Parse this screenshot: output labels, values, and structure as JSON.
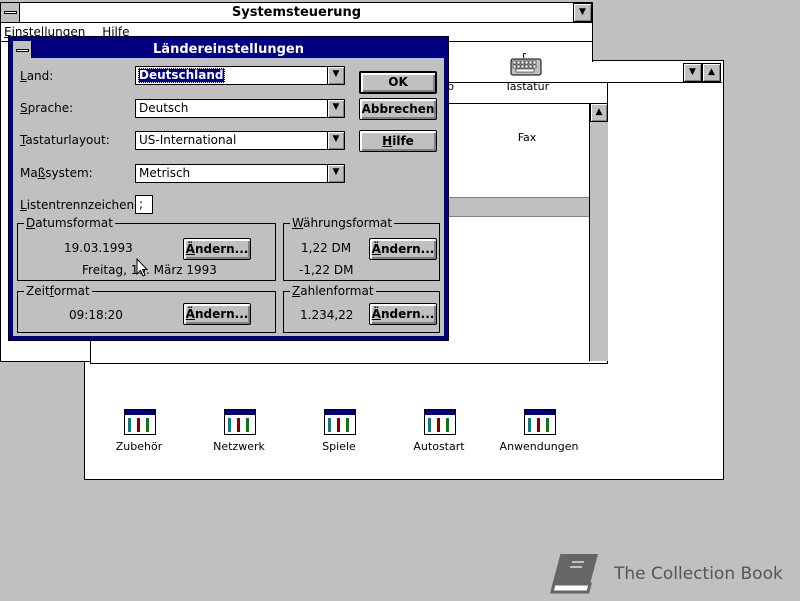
{
  "control_panel": {
    "title": "Systemsteuerung",
    "menu": [
      "Einstellungen",
      "Hilfe"
    ],
    "icons": [
      {
        "label": "Tastatur",
        "icon": "keyboard-icon"
      },
      {
        "label": "Fax",
        "icon": "fax-icon"
      }
    ],
    "partial_label": "p"
  },
  "program_manager": {
    "groups": [
      {
        "label": "Zubehör",
        "icon": "program-group-icon"
      },
      {
        "label": "Netzwerk",
        "icon": "program-group-icon"
      },
      {
        "label": "Spiele",
        "icon": "program-group-icon"
      },
      {
        "label": "Autostart",
        "icon": "program-group-icon"
      },
      {
        "label": "Anwendungen",
        "icon": "program-group-icon"
      }
    ]
  },
  "dialog": {
    "title": "Ländereinstellungen",
    "fields": {
      "land": {
        "label_u": "L",
        "label_rest": "and:",
        "value": "Deutschland"
      },
      "sprache": {
        "label_u": "S",
        "label_rest": "prache:",
        "value": "Deutsch"
      },
      "tastatur": {
        "label_u": "T",
        "label_rest": "astaturlayout:",
        "value": "US-International"
      },
      "mass": {
        "label_pre": "Ma",
        "label_u": "ß",
        "label_rest": "system:",
        "value": "Metrisch"
      },
      "listen": {
        "label_pre": "",
        "label_u": "L",
        "label_rest": "istentrennzeichen:",
        "value": ";"
      }
    },
    "buttons": {
      "ok": "OK",
      "cancel": "Abbrechen",
      "help_u": "H",
      "help_rest": "ilfe"
    },
    "groups": {
      "datum": {
        "title_u": "D",
        "title_rest": "atumsformat",
        "short": "19.03.1993",
        "long": "Freitag, 19. März 1993"
      },
      "waehrung": {
        "title_u": "W",
        "title_rest": "ährungsformat",
        "positive": "1,22 DM",
        "negative": "-1,22 DM"
      },
      "zeit": {
        "title_pre": "Zeit",
        "title_u": "f",
        "title_rest": "ormat",
        "value": "09:18:20"
      },
      "zahlen": {
        "title_u": "Z",
        "title_rest": "ahlenformat",
        "value": "1.234,22"
      }
    },
    "change_label_u": "Ä",
    "change_label_rest": "ndern..."
  },
  "watermark": {
    "text": "The Collection Book",
    "icon": "book-logo-icon"
  }
}
